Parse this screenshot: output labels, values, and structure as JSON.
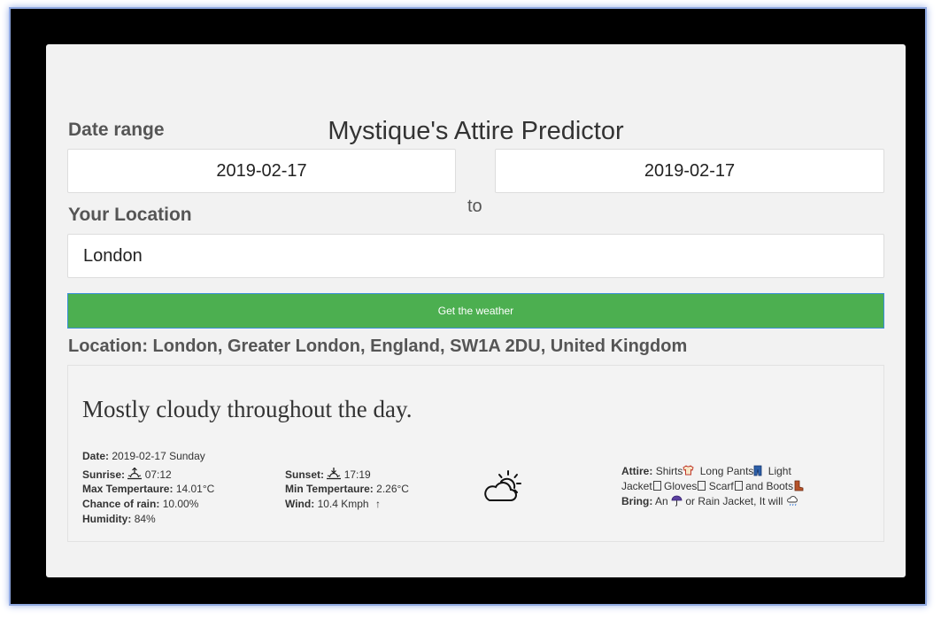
{
  "app": {
    "title": "Mystique's Attire Predictor"
  },
  "date_range": {
    "label": "Date range",
    "from": "2019-02-17",
    "separator": "to",
    "to": "2019-02-17"
  },
  "location_input": {
    "label": "Your Location",
    "value": "London"
  },
  "button": {
    "label": "Get the weather",
    "color": "#4caf50"
  },
  "location_result": "Location: London, Greater London, England, SW1A 2DU, United Kingdom",
  "forecast": {
    "summary": "Mostly cloudy throughout the day.",
    "date_label": "Date:",
    "date_value": "2019-02-17 Sunday",
    "sunrise_label": "Sunrise:",
    "sunrise_value": "07:12",
    "sunset_label": "Sunset:",
    "sunset_value": "17:19",
    "max_temp_label": "Max Tempertaure:",
    "max_temp_value": "14.01°C",
    "min_temp_label": "Min Tempertaure:",
    "min_temp_value": "2.26°C",
    "rain_label": "Chance of rain:",
    "rain_value": "10.00%",
    "wind_label": "Wind:",
    "wind_value": "10.4 Kmph",
    "wind_arrow": "↑",
    "humidity_label": "Humidity:",
    "humidity_value": "84%",
    "icon": "partly-cloudy-day-icon"
  },
  "attire": {
    "attire_label": "Attire:",
    "item_shirts": "Shirts",
    "item_pants": "Long Pants",
    "item_jacket": "Light Jacket",
    "item_gloves": "Gloves",
    "item_scarf": "Scarf",
    "item_boots": "and Boots",
    "bring_label": "Bring:",
    "bring_text_1": "An",
    "bring_text_2": "or Rain Jacket, It will",
    "icons": [
      "shirt-icon",
      "pants-icon",
      "boot-icon",
      "umbrella-icon",
      "rain-cloud-icon"
    ]
  }
}
